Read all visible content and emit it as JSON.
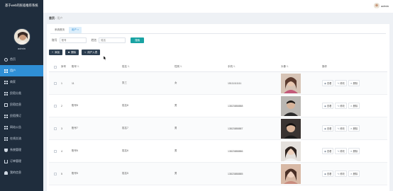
{
  "sidebar": {
    "title": "基于web的民宿推荐系统",
    "admin_name": "admin",
    "items": [
      {
        "label": "首页",
        "icon": "home-icon"
      },
      {
        "label": "用户",
        "icon": "grid-icon"
      },
      {
        "label": "商家",
        "icon": "grid-icon"
      },
      {
        "label": "民宿分类",
        "icon": "grid-icon"
      },
      {
        "label": "民宿信息",
        "icon": "monitor-icon"
      },
      {
        "label": "民宿预订",
        "icon": "grid-icon"
      },
      {
        "label": "网站公告",
        "icon": "grid-icon"
      },
      {
        "label": "在线交流",
        "icon": "grid-icon"
      },
      {
        "label": "系统管理",
        "icon": "shield-icon"
      },
      {
        "label": "订单管理",
        "icon": "cart-icon"
      },
      {
        "label": "我的信息",
        "icon": "user-icon"
      }
    ]
  },
  "topbar": {
    "user": "admin"
  },
  "breadcrumb": {
    "home": "首页",
    "sep": "/",
    "current": "用户"
  },
  "tabs": [
    "系统首页",
    "用户 ×"
  ],
  "search": {
    "account_label": "账号",
    "account_placeholder": "账号",
    "name_label": "姓名",
    "name_placeholder": "姓名",
    "button": "搜索"
  },
  "actions": {
    "add": "添加",
    "delete": "删除",
    "import": "用户入表"
  },
  "table": {
    "headers": [
      "序号",
      "账号",
      "姓名",
      "性别",
      "手机",
      "头像",
      "操作"
    ],
    "rows": [
      {
        "idx": "1",
        "account": "11",
        "name": "张三",
        "sex": "女",
        "phone": "15111111111"
      },
      {
        "idx": "2",
        "account": "账号8",
        "name": "姓名8",
        "sex": "男",
        "phone": "13823888888"
      },
      {
        "idx": "3",
        "account": "账号7",
        "name": "姓名7",
        "sex": "男",
        "phone": "13823888887"
      },
      {
        "idx": "4",
        "account": "账号6",
        "name": "姓名6",
        "sex": "男",
        "phone": "13823888886"
      },
      {
        "idx": "5",
        "account": "账号5",
        "name": "姓名5",
        "sex": "男",
        "phone": "13823888885"
      }
    ],
    "ops": {
      "view": "查看",
      "edit": "修改",
      "delete": "删除"
    }
  },
  "colors": {
    "sidebar_bg": "#1f2d3d",
    "active_blue": "#2f8fd6",
    "teal": "#19a3a3",
    "dark_button": "#2c3e50"
  }
}
